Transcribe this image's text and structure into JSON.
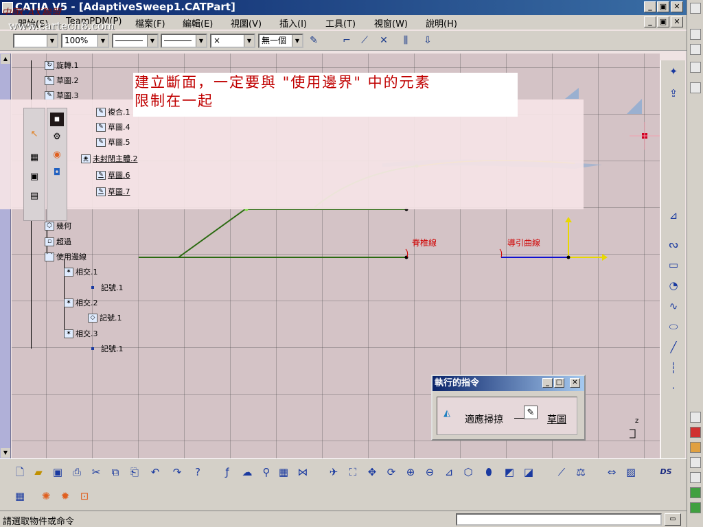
{
  "window": {
    "title": "CATIA V5 - [AdaptiveSweep1.CATPart]",
    "watermark_cn": "中國CAX聯盟",
    "watermark_url": "www.cartech8.com"
  },
  "menu": [
    "開始(S)",
    "TeamPDM(P)",
    "檔案(F)",
    "編輯(E)",
    "視圖(V)",
    "插入(I)",
    "工具(T)",
    "視窗(W)",
    "說明(H)"
  ],
  "properties": {
    "zoom": "100%",
    "layer": "無一個",
    "point_style": "×"
  },
  "tree": [
    {
      "label": "旋轉.1",
      "icon": "revolve-icon"
    },
    {
      "label": "草圖.2",
      "icon": "sketch-icon"
    },
    {
      "label": "草圖.3",
      "icon": "sketch-icon"
    },
    {
      "label": "複合.1",
      "icon": "sketch-icon"
    },
    {
      "label": "草圖.4",
      "icon": "sketch-icon"
    },
    {
      "label": "草圖.5",
      "icon": "sketch-icon"
    },
    {
      "label": "未封閉主體.2",
      "icon": "body-icon"
    },
    {
      "label": "草圖.6",
      "icon": "sketch-icon"
    },
    {
      "label": "草圖.7",
      "icon": "sketch-icon"
    },
    {
      "label": "幾何",
      "icon": "geometry-icon"
    },
    {
      "label": "超過",
      "icon": "exceed-icon"
    },
    {
      "label": "使用邊線",
      "icon": "use-edge-icon"
    },
    {
      "label": "相交.1",
      "icon": "intersect-icon"
    },
    {
      "label": "記號.1",
      "icon": "point-icon"
    },
    {
      "label": "相交.2",
      "icon": "intersect-icon"
    },
    {
      "label": "記號.1",
      "icon": "plane-icon"
    },
    {
      "label": "相交.3",
      "icon": "intersect-icon"
    },
    {
      "label": "記號.1",
      "icon": "point-icon"
    }
  ],
  "annotation": {
    "line1": "建立斷面，一定要與 \"使用邊界\" 中的元素",
    "line2": "限制在一起",
    "line2_shadow": "限制在一起"
  },
  "canvas_labels": {
    "spine": "脊椎線",
    "guide": "導引曲線",
    "axis_z": "z"
  },
  "command_dialog": {
    "title": "執行的指令",
    "command1": "適應掃掠",
    "command2": "草圖"
  },
  "status": {
    "prompt": "請選取物件或命令"
  },
  "colors": {
    "title_bar": "#0a246a",
    "annotation": "#c00000",
    "curve_dark_green": "#2a6a10",
    "curve_light_green": "#7ae040",
    "guide_blue": "#1010d0",
    "axis_yellow": "#e8d800"
  }
}
